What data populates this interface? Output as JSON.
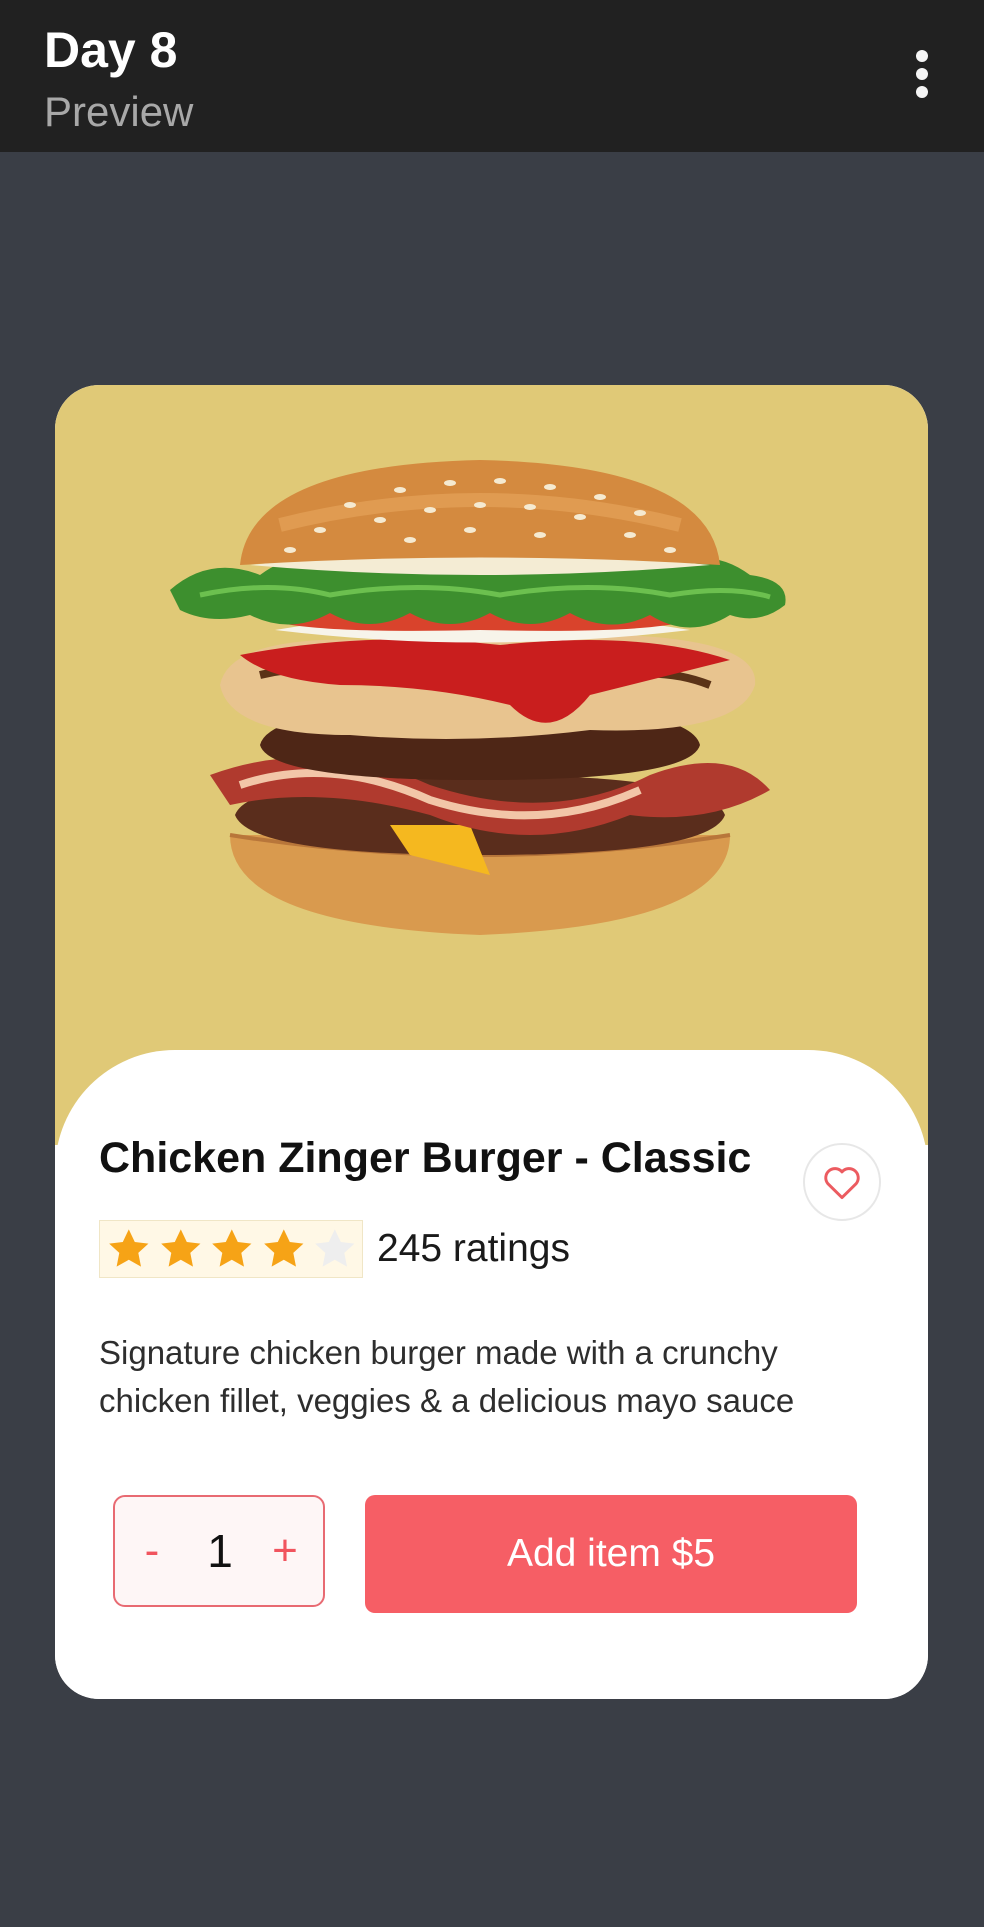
{
  "appbar": {
    "title": "Day 8",
    "subtitle": "Preview",
    "menu_icon": "more-vertical-icon"
  },
  "product": {
    "image_icon": "burger-image",
    "title": "Chicken Zinger Burger - Classic",
    "favorite_icon": "heart-outline-icon",
    "rating": 4,
    "rating_max": 5,
    "ratings_text": "245 ratings",
    "description": "Signature chicken burger made with a crunchy chicken fillet, veggies & a delicious mayo sauce"
  },
  "cart": {
    "minus_label": "-",
    "quantity": "1",
    "plus_label": "+",
    "add_button_label": "Add item $5"
  },
  "colors": {
    "background": "#3a3e46",
    "appbar": "#212121",
    "image_bg": "#e0c977",
    "accent": "#f65e65",
    "star_filled": "#f6a316",
    "star_empty": "#eeeeee"
  }
}
